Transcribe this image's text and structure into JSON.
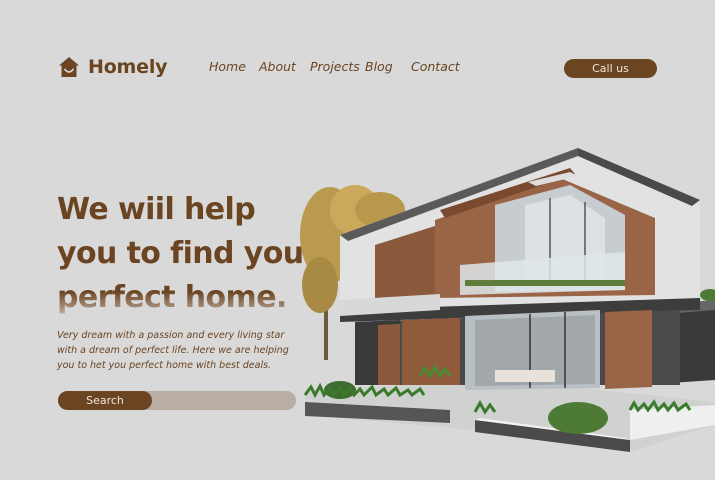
{
  "brand": {
    "name": "Homely",
    "icon": "house-icon"
  },
  "nav": {
    "items": [
      {
        "label": "Home"
      },
      {
        "label": "About"
      },
      {
        "label": "Projects"
      },
      {
        "label": "Blog"
      },
      {
        "label": "Contact"
      }
    ]
  },
  "header": {
    "cta_label": "Call us"
  },
  "hero": {
    "headline_lines": [
      "We wiil help",
      "you to find your",
      "perfect home."
    ],
    "description": "Very dream with a passion and every living star with a dream of perfect life. Here we are helping you to het you perfect home with best deals.",
    "search_label": "Search"
  },
  "colors": {
    "background": "#d9d9d9",
    "brand": "#6b4421",
    "button_text": "#f2e6d8",
    "search_track": "#b8aea3"
  }
}
